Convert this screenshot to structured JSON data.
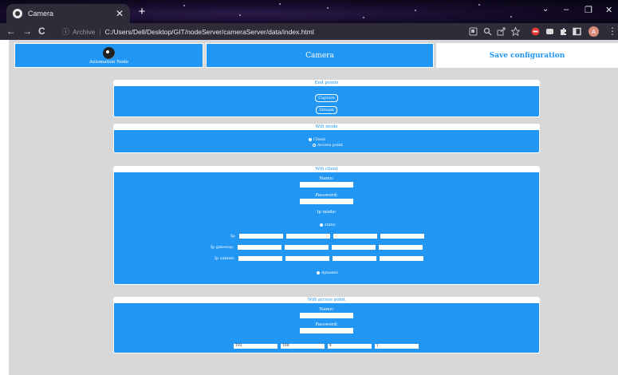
{
  "browser": {
    "tab_title": "Camera",
    "tab_close": "✕",
    "new_tab": "+",
    "url_prefix": "Archive",
    "url": "C:/Users/Dell/Desktop/GIT/nodeServer/cameraServer/data/index.html",
    "controls": {
      "minimize": "–",
      "maximize": "❐",
      "close": "✕"
    },
    "nav": {
      "back": "←",
      "forward": "→",
      "reload": "C"
    }
  },
  "nav": {
    "logo_text": "Automation Node",
    "camera": "Camera",
    "save": "Save configuration"
  },
  "endpoints": {
    "title": "End points",
    "capture": "Capture",
    "stream": "Stream"
  },
  "wifi_mode": {
    "title": "Wifi mode",
    "client": "Client",
    "access_point": "Access point",
    "selected": "Client"
  },
  "wifi_client": {
    "title": "Wifi client",
    "name_label": "Name:",
    "password_label": "Password:",
    "ip_mode_label": "Ip mode:",
    "static": "static",
    "ip_label": "Ip:",
    "gateway_label": "Ip gateway:",
    "subnet_label": "Ip subnet:",
    "dynamic": "dynamic"
  },
  "wifi_ap": {
    "title": "Wifi access point",
    "name_label": "Name:",
    "password_label": "Password:",
    "ip": [
      "192",
      "168",
      "4",
      "1"
    ]
  },
  "colors": {
    "primary": "#2196f3",
    "page_bg": "#d8d8d8",
    "card_text": "#ffffff"
  }
}
